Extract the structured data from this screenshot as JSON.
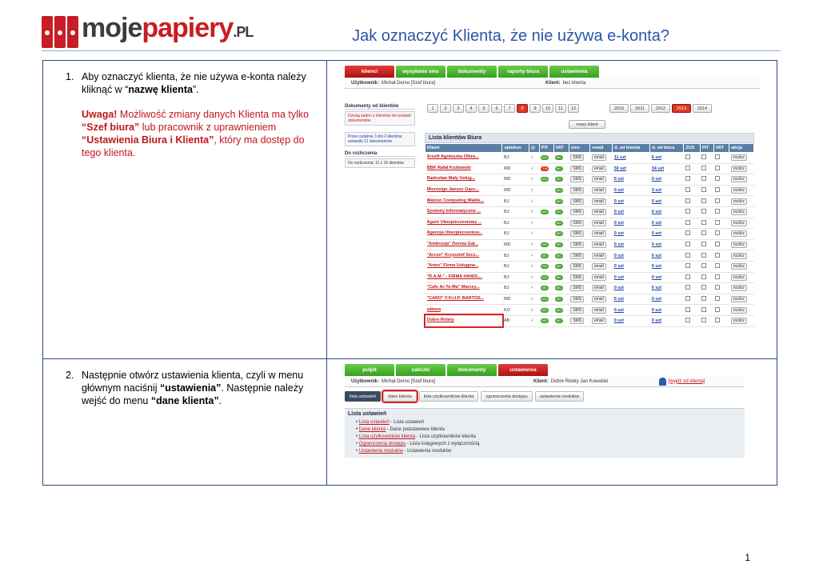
{
  "header": {
    "logo_part1": "moje",
    "logo_part2": "papiery",
    "logo_part3": ".PL",
    "title": "Jak oznaczyć Klienta, że nie używa e-konta?"
  },
  "step1": {
    "num": "1.",
    "t1": "Aby oznaczyć klienta, że nie używa e-konta należy kliknąć w “",
    "t2": "nazwę klienta",
    "t3": "”.",
    "warn_label": "Uwaga!",
    "w1": " Możliwość zmiany danych Klienta ma tylko ",
    "w2": "“Szef biura”",
    "w3": " lub pracownik z uprawnieniem ",
    "w4": "“Ustawienia Biura i Klienta”",
    "w5": ", który ma dostęp do tego klienta."
  },
  "step2": {
    "num": "2.",
    "t1": "Następnie otwórz ustawienia klienta, czyli w menu głównym naciśnij ",
    "t2": "“ustawienia”",
    "t3": ". Następnie należy wejść do menu ",
    "t4": "“dane klienta”",
    "t5": "."
  },
  "shot1": {
    "tabs": [
      "klienci",
      "wysyłanie sms",
      "dokumenty",
      "raporty biura",
      "ustawienia"
    ],
    "user_label": "Użytkownik:",
    "user": "Michał Demo [Szef biura]",
    "client_label": "Klient:",
    "client": "bez klienta",
    "side1_head": "Dokumenty od klientów",
    "side1_box1": "Dzisiaj żaden z klientów nie wstawił dokumentów.",
    "side1_box2": "Przez ostatnie 3 dni 2 klientów wstawiło 11 dokumentów",
    "side2_head": "Do rozliczenia",
    "side2_box": "Do rozliczenia: 11 z 16 klientów.",
    "pages": [
      "1",
      "2",
      "3",
      "4",
      "5",
      "6",
      "7",
      "8",
      "9",
      "10",
      "11",
      "12"
    ],
    "years": [
      "2010",
      "2011",
      "2012",
      "2013",
      "2014"
    ],
    "new_client": "nowy klient",
    "list_title": "Lista klientów Biura",
    "cols": [
      "Klient",
      "opiekun",
      "@",
      "PIT",
      "VAT",
      "sms",
      "email",
      "d. od klienta",
      "d. od biura",
      "ZUS",
      "PIT",
      "VAT",
      "akcja"
    ],
    "rows": [
      [
        "Arsoft Agnieszka Olbra...",
        "BJ",
        "SMS",
        "email",
        "11 szt",
        "6 szt",
        "rozlicz"
      ],
      [
        "BBK Rafał Kozłowski",
        "MD",
        "SMS",
        "email",
        "50 szt",
        "34 szt",
        "rozlicz"
      ],
      [
        "Radosław Mały Usług...",
        "MD",
        "SMS",
        "email",
        "0 szt",
        "0 szt",
        "rozlicz"
      ],
      [
        "Microsign Janusz Gąsc...",
        "MD",
        "SMS",
        "email",
        "0 szt",
        "3 szt",
        "rozlicz"
      ],
      [
        "Walzon Computing Walde...",
        "BJ",
        "SMS",
        "email",
        "0 szt",
        "0 szt",
        "rozlicz"
      ],
      [
        "Systemy Informatyczne ...",
        "BJ",
        "SMS",
        "email",
        "0 szt",
        "0 szt",
        "rozlicz"
      ],
      [
        "Agent Ubezpieczeniowy ...",
        "BJ",
        "SMS",
        "email",
        "0 szt",
        "0 szt",
        "rozlicz"
      ],
      [
        "Agencja Ubezpieczeniow...",
        "BJ",
        "SMS",
        "email",
        "0 szt",
        "0 szt",
        "rozlicz"
      ],
      [
        "\"Ambrozja\" Dorota Gał...",
        "MD",
        "SMS",
        "email",
        "0 szt",
        "0 szt",
        "rozlicz"
      ],
      [
        "\"Arcon\" Krzysztof Szcz...",
        "BJ",
        "SMS",
        "email",
        "0 szt",
        "0 szt",
        "rozlicz"
      ],
      [
        "\"Artex\" Firma Usługow...",
        "BJ",
        "SMS",
        "email",
        "0 szt",
        "0 szt",
        "rozlicz"
      ],
      [
        "\"R.A.M.\" - FIRMA HANDL...",
        "BJ",
        "SMS",
        "email",
        "0 szt",
        "0 szt",
        "rozlicz"
      ],
      [
        "\"Cafe Ar-Te-Ma\" Marczy...",
        "BJ",
        "SMS",
        "email",
        "0 szt",
        "0 szt",
        "rozlicz"
      ],
      [
        "\"CARO\" F.H.U.P. BARTOS...",
        "MD",
        "SMS",
        "email",
        "0 szt",
        "0 szt",
        "rozlicz"
      ],
      [
        "zabora",
        "KO",
        "SMS",
        "email",
        "0 szt",
        "0 szt",
        "rozlicz"
      ],
      [
        "Dobre Rolety",
        "AB",
        "SMS",
        "email",
        "0 szt",
        "0 szt",
        "rozlicz"
      ]
    ]
  },
  "shot2": {
    "tabs": [
      "pulpit",
      "zaliczki",
      "dokumenty",
      "ustawienia"
    ],
    "user_label": "Użytkownik:",
    "user": "Michał Demo [Szef biura]",
    "client_label": "Klient:",
    "client": "Dobre Rolety Jan Kowalski",
    "logout": "[wyjdź od klienta]",
    "subtabs": [
      "lista ustawień",
      "dane klienta",
      "lista użytkowników klienta",
      "ograniczenia dostępu",
      "ustawienia modułów"
    ],
    "list_title": "Lista ustawień",
    "items": [
      [
        "Lista ustawień",
        " - Lista ustawień"
      ],
      [
        "Dane klienta",
        " - Dane podstawowe klienta"
      ],
      [
        "Lista użytkowników klienta",
        " - Lista użytkowników klienta"
      ],
      [
        "Ograniczenia dostępu",
        " - Lista księgowych z wyłącznością"
      ],
      [
        "Ustawienia modułów",
        " - Ustawienia modułów"
      ]
    ]
  },
  "page_number": "1"
}
